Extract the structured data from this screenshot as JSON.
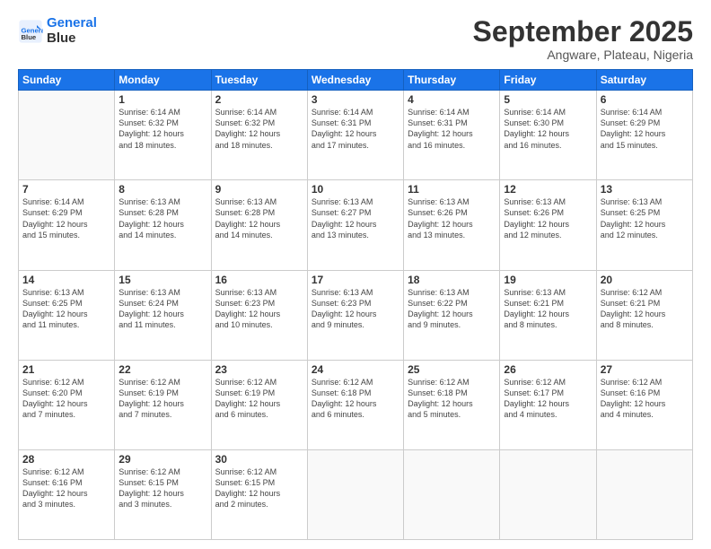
{
  "logo": {
    "line1": "General",
    "line2": "Blue"
  },
  "title": "September 2025",
  "location": "Angware, Plateau, Nigeria",
  "days_header": [
    "Sunday",
    "Monday",
    "Tuesday",
    "Wednesday",
    "Thursday",
    "Friday",
    "Saturday"
  ],
  "weeks": [
    [
      {
        "day": "",
        "info": ""
      },
      {
        "day": "1",
        "info": "Sunrise: 6:14 AM\nSunset: 6:32 PM\nDaylight: 12 hours\nand 18 minutes."
      },
      {
        "day": "2",
        "info": "Sunrise: 6:14 AM\nSunset: 6:32 PM\nDaylight: 12 hours\nand 18 minutes."
      },
      {
        "day": "3",
        "info": "Sunrise: 6:14 AM\nSunset: 6:31 PM\nDaylight: 12 hours\nand 17 minutes."
      },
      {
        "day": "4",
        "info": "Sunrise: 6:14 AM\nSunset: 6:31 PM\nDaylight: 12 hours\nand 16 minutes."
      },
      {
        "day": "5",
        "info": "Sunrise: 6:14 AM\nSunset: 6:30 PM\nDaylight: 12 hours\nand 16 minutes."
      },
      {
        "day": "6",
        "info": "Sunrise: 6:14 AM\nSunset: 6:29 PM\nDaylight: 12 hours\nand 15 minutes."
      }
    ],
    [
      {
        "day": "7",
        "info": "Sunrise: 6:14 AM\nSunset: 6:29 PM\nDaylight: 12 hours\nand 15 minutes."
      },
      {
        "day": "8",
        "info": "Sunrise: 6:13 AM\nSunset: 6:28 PM\nDaylight: 12 hours\nand 14 minutes."
      },
      {
        "day": "9",
        "info": "Sunrise: 6:13 AM\nSunset: 6:28 PM\nDaylight: 12 hours\nand 14 minutes."
      },
      {
        "day": "10",
        "info": "Sunrise: 6:13 AM\nSunset: 6:27 PM\nDaylight: 12 hours\nand 13 minutes."
      },
      {
        "day": "11",
        "info": "Sunrise: 6:13 AM\nSunset: 6:26 PM\nDaylight: 12 hours\nand 13 minutes."
      },
      {
        "day": "12",
        "info": "Sunrise: 6:13 AM\nSunset: 6:26 PM\nDaylight: 12 hours\nand 12 minutes."
      },
      {
        "day": "13",
        "info": "Sunrise: 6:13 AM\nSunset: 6:25 PM\nDaylight: 12 hours\nand 12 minutes."
      }
    ],
    [
      {
        "day": "14",
        "info": "Sunrise: 6:13 AM\nSunset: 6:25 PM\nDaylight: 12 hours\nand 11 minutes."
      },
      {
        "day": "15",
        "info": "Sunrise: 6:13 AM\nSunset: 6:24 PM\nDaylight: 12 hours\nand 11 minutes."
      },
      {
        "day": "16",
        "info": "Sunrise: 6:13 AM\nSunset: 6:23 PM\nDaylight: 12 hours\nand 10 minutes."
      },
      {
        "day": "17",
        "info": "Sunrise: 6:13 AM\nSunset: 6:23 PM\nDaylight: 12 hours\nand 9 minutes."
      },
      {
        "day": "18",
        "info": "Sunrise: 6:13 AM\nSunset: 6:22 PM\nDaylight: 12 hours\nand 9 minutes."
      },
      {
        "day": "19",
        "info": "Sunrise: 6:13 AM\nSunset: 6:21 PM\nDaylight: 12 hours\nand 8 minutes."
      },
      {
        "day": "20",
        "info": "Sunrise: 6:12 AM\nSunset: 6:21 PM\nDaylight: 12 hours\nand 8 minutes."
      }
    ],
    [
      {
        "day": "21",
        "info": "Sunrise: 6:12 AM\nSunset: 6:20 PM\nDaylight: 12 hours\nand 7 minutes."
      },
      {
        "day": "22",
        "info": "Sunrise: 6:12 AM\nSunset: 6:19 PM\nDaylight: 12 hours\nand 7 minutes."
      },
      {
        "day": "23",
        "info": "Sunrise: 6:12 AM\nSunset: 6:19 PM\nDaylight: 12 hours\nand 6 minutes."
      },
      {
        "day": "24",
        "info": "Sunrise: 6:12 AM\nSunset: 6:18 PM\nDaylight: 12 hours\nand 6 minutes."
      },
      {
        "day": "25",
        "info": "Sunrise: 6:12 AM\nSunset: 6:18 PM\nDaylight: 12 hours\nand 5 minutes."
      },
      {
        "day": "26",
        "info": "Sunrise: 6:12 AM\nSunset: 6:17 PM\nDaylight: 12 hours\nand 4 minutes."
      },
      {
        "day": "27",
        "info": "Sunrise: 6:12 AM\nSunset: 6:16 PM\nDaylight: 12 hours\nand 4 minutes."
      }
    ],
    [
      {
        "day": "28",
        "info": "Sunrise: 6:12 AM\nSunset: 6:16 PM\nDaylight: 12 hours\nand 3 minutes."
      },
      {
        "day": "29",
        "info": "Sunrise: 6:12 AM\nSunset: 6:15 PM\nDaylight: 12 hours\nand 3 minutes."
      },
      {
        "day": "30",
        "info": "Sunrise: 6:12 AM\nSunset: 6:15 PM\nDaylight: 12 hours\nand 2 minutes."
      },
      {
        "day": "",
        "info": ""
      },
      {
        "day": "",
        "info": ""
      },
      {
        "day": "",
        "info": ""
      },
      {
        "day": "",
        "info": ""
      }
    ]
  ]
}
